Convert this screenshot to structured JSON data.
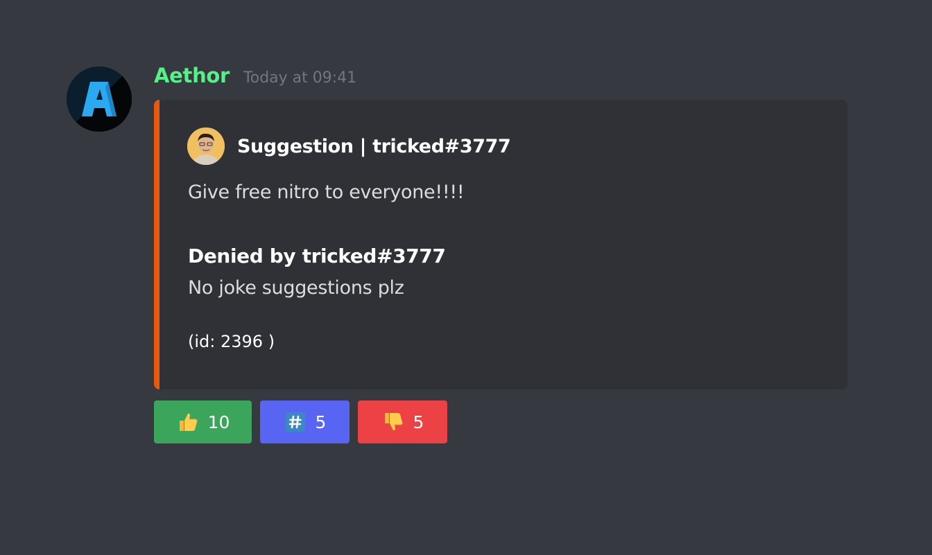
{
  "message": {
    "username": "Aethor",
    "timestamp": "Today at 09:41",
    "colors": {
      "username": "#57f287",
      "background": "#36393f"
    }
  },
  "embed": {
    "author": "Suggestion | tricked#3777",
    "description": "Give free nitro to everyone!!!!",
    "field": {
      "name": "Denied by tricked#3777",
      "value": "No joke suggestions plz"
    },
    "footer": "(id: 2396 )",
    "accent_color": "#e8590c"
  },
  "buttons": [
    {
      "icon": "thumbs-up-icon",
      "count": "10",
      "color": "#3ba55c"
    },
    {
      "icon": "hash-keycap-icon",
      "count": "5",
      "color": "#5865f2"
    },
    {
      "icon": "thumbs-down-icon",
      "count": "5",
      "color": "#ed4245"
    }
  ]
}
